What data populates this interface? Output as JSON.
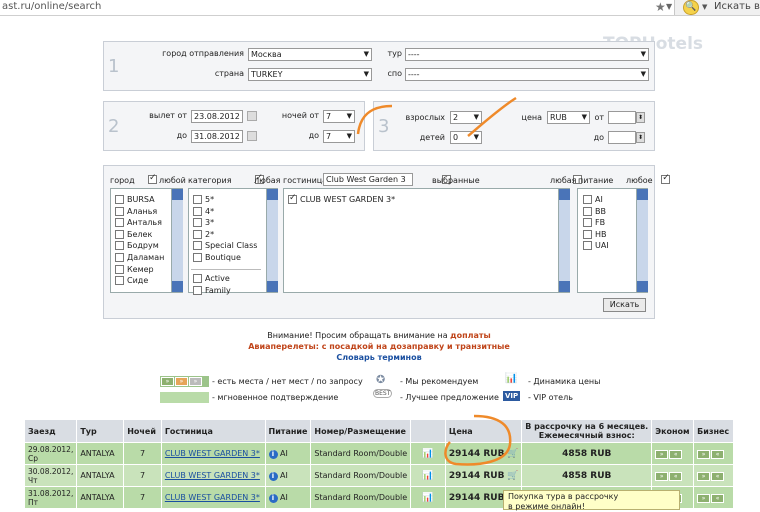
{
  "browser": {
    "url": "ast.ru/online/search",
    "search_placeholder": "Искать в"
  },
  "watermark": {
    "line1": "TOP",
    "line2": "Hotels"
  },
  "block1": {
    "num": "1",
    "dep_city_label": "город отправления",
    "dep_city_value": "Москва",
    "country_label": "страна",
    "country_value": "TURKEY",
    "tour_label": "тур",
    "tour_value": "----",
    "spo_label": "спо",
    "spo_value": "----"
  },
  "block2": {
    "num": "2",
    "dep_from_label": "вылет от",
    "dep_from_value": "23.08.2012",
    "dep_to_label": "до",
    "dep_to_value": "31.08.2012",
    "nights_from_label": "ночей от",
    "nights_from_value": "7",
    "nights_to_label": "до",
    "nights_to_value": "7"
  },
  "block3": {
    "num": "3",
    "adults_label": "взрослых",
    "adults_value": "2",
    "children_label": "детей",
    "children_value": "0",
    "price_label": "цена",
    "currency_value": "RUB",
    "price_from_label": "от",
    "price_to_label": "до"
  },
  "filters": {
    "city_label": "город",
    "any_label": "любой",
    "category_label": "категория",
    "any_fem_label": "любая",
    "hotel_label": "гостиница",
    "hotel_input": "Club West Garden 3",
    "selected_label": "выбранные",
    "any_hotel_label": "любая",
    "meal_label": "питание",
    "any_meal_label": "любое",
    "cities": [
      "BURSA",
      "Аланья",
      "Анталья",
      "Белек",
      "Бодрум",
      "Даламан",
      "Кемер",
      "Сиде"
    ],
    "categories": [
      "5*",
      "4*",
      "3*",
      "2*",
      "Special Class",
      "Boutique"
    ],
    "categories2": [
      "Active",
      "Family"
    ],
    "hotels": [
      "CLUB WEST GARDEN 3*"
    ],
    "meals": [
      "AI",
      "BB",
      "FB",
      "HB",
      "UAI"
    ],
    "search_button": "Искать"
  },
  "notice": {
    "line1_prefix": "Внимание! Просим обращать внимание на ",
    "line1_link": "доплаты",
    "line2_link": "Авиаперелеты: с посадкой на дозаправку и транзитные",
    "line3_link": "Словарь терминов"
  },
  "legend": {
    "avail": "- есть места / нет мест / по запросу",
    "instant": "- мгновенное подтверждение",
    "recommend": "- Мы рекомендуем",
    "best": "- Лучшее предложение",
    "dynamics": "- Динамика цены",
    "vip": "- VIP отель",
    "vip_badge": "VIP",
    "best_badge": "BEST"
  },
  "table": {
    "headers": {
      "date": "Заезд",
      "tour": "Тур",
      "nights": "Ночей",
      "hotel": "Гостиница",
      "meal": "Питание",
      "room": "Номер/Размещение",
      "price": "Цена",
      "install1": "В рассрочку на 6 месяцев.",
      "install2": "Ежемесячный взнос:",
      "econom": "Эконом",
      "business": "Бизнес"
    },
    "rows": [
      {
        "date1": "29.08.2012,",
        "date2": "Ср",
        "tour": "ANTALYA",
        "nights": "7",
        "hotel": "CLUB WEST GARDEN 3*",
        "meal": "AI",
        "room": "Standard Room/Double",
        "price": "29144 RUB",
        "install": "4858 RUB"
      },
      {
        "date1": "30.08.2012,",
        "date2": "Чт",
        "tour": "ANTALYA",
        "nights": "7",
        "hotel": "CLUB WEST GARDEN 3*",
        "meal": "AI",
        "room": "Standard Room/Double",
        "price": "29144 RUB",
        "install": "4858 RUB"
      },
      {
        "date1": "31.08.2012,",
        "date2": "Пт",
        "tour": "ANTALYA",
        "nights": "7",
        "hotel": "CLUB WEST GARDEN 3*",
        "meal": "AI",
        "room": "Standard Room/Double",
        "price": "29144 RUB",
        "install": ""
      }
    ]
  },
  "tooltip": {
    "line1": "Покупка тура в рассрочку",
    "line2": "в режиме онлайн!"
  }
}
